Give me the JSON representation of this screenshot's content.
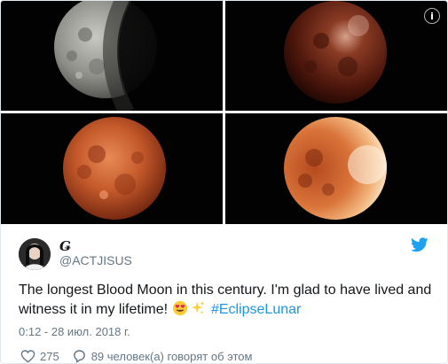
{
  "tweet": {
    "author_name": "Ǥ",
    "handle": "@ACTJISUS",
    "text_main": "The longest Blood Moon in this century. I'm glad to have lived and witness it in my lifetime! ",
    "hashtag": "#EclipseLunar",
    "timestamp": "0:12 - 28 июл. 2018 г.",
    "like_count": "275",
    "reply_text": "89 человек(а) говорят об этом"
  },
  "media": {
    "photos": [
      "moon-partial-eclipse",
      "moon-blood-dark",
      "moon-blood-full",
      "moon-blood-ending"
    ],
    "info_icon": "info-icon"
  },
  "icons": {
    "bird": "twitter-bird-icon",
    "heart": "heart-icon",
    "reply": "reply-icon",
    "emoji_heart_eyes": "heart-eyes-emoji-icon",
    "emoji_sparkles": "sparkles-emoji-icon"
  },
  "colors": {
    "link": "#1b95e0",
    "muted": "#657786",
    "text": "#14171a"
  }
}
